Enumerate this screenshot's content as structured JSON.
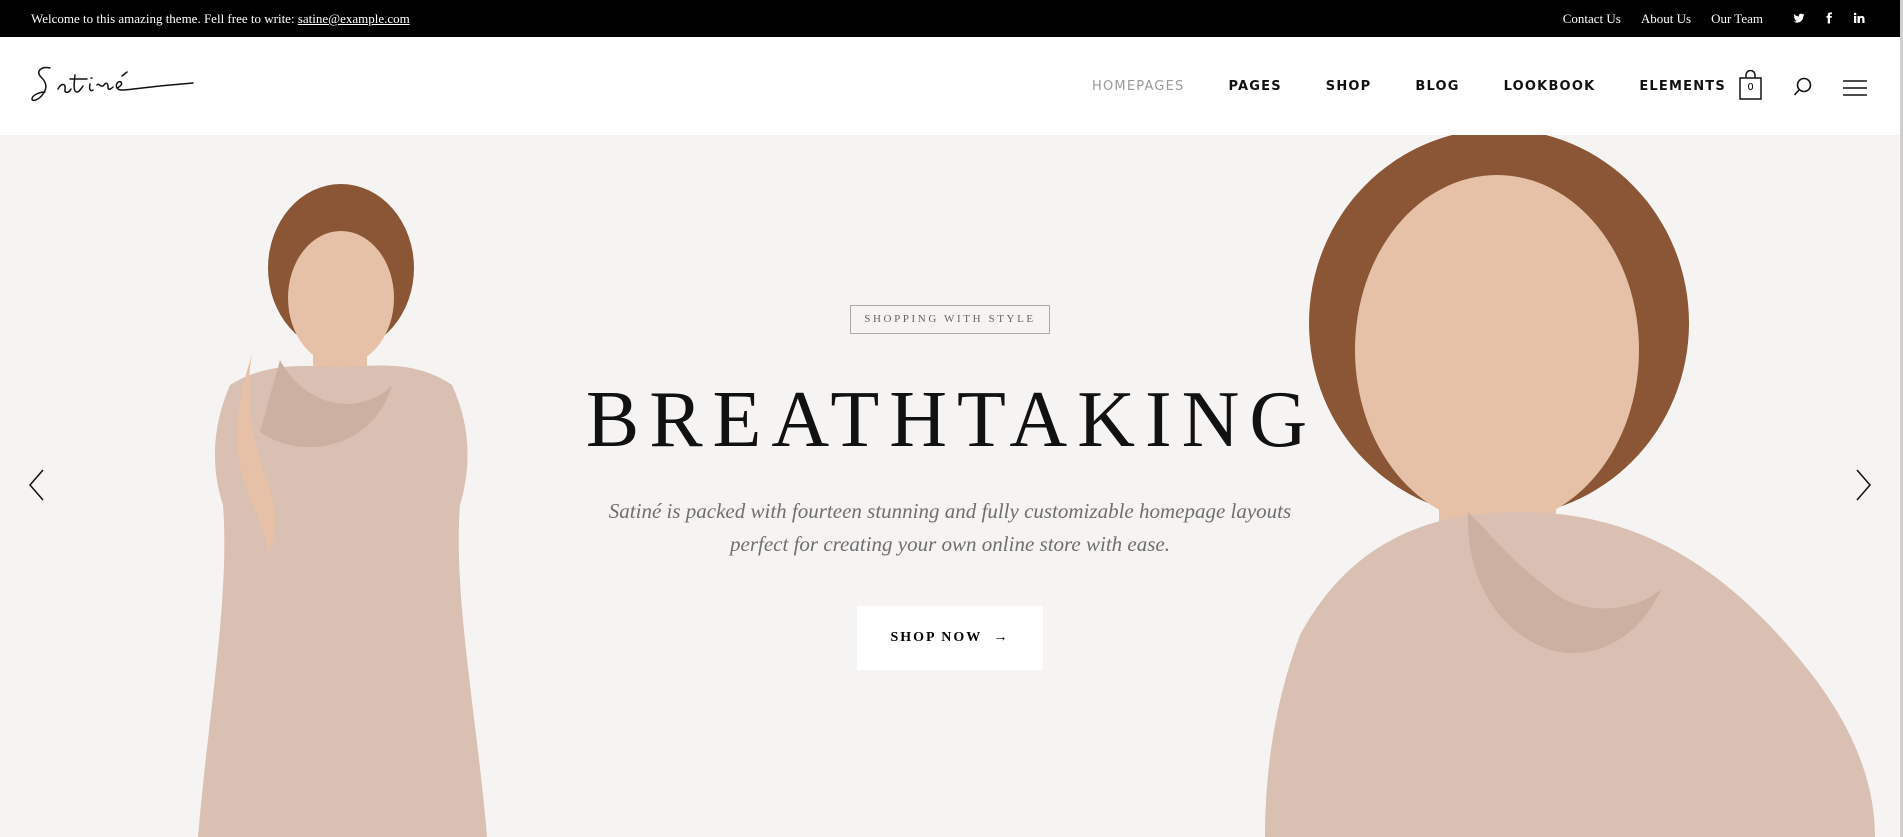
{
  "topbar": {
    "welcome_text": "Welcome to this amazing theme. Fell free to write:",
    "email": "satine@example.com",
    "links": [
      "Contact Us",
      "About Us",
      "Our Team"
    ],
    "social_icons": [
      "twitter-icon",
      "facebook-icon",
      "linkedin-icon"
    ]
  },
  "header": {
    "logo_text": "Satiné",
    "nav": [
      "HOMEPAGES",
      "PAGES",
      "SHOP",
      "BLOG",
      "LOOKBOOK",
      "ELEMENTS"
    ],
    "active_nav": "HOMEPAGES",
    "cart_count": "0"
  },
  "hero": {
    "tag": "SHOPPING WITH STYLE",
    "headline": "BREATHTAKING",
    "subtitle_line1": "Satiné is packed with fourteen stunning and fully customizable homepage layouts",
    "subtitle_line2": "perfect for creating your own online store with ease.",
    "cta": "SHOP NOW",
    "arrow_glyph": "→"
  },
  "colors": {
    "topbar_bg": "#000000",
    "hero_bg": "#f6f4f2",
    "dress": "#d9c0b2",
    "skin": "#e7c1a7",
    "hair": "#8a5636"
  }
}
